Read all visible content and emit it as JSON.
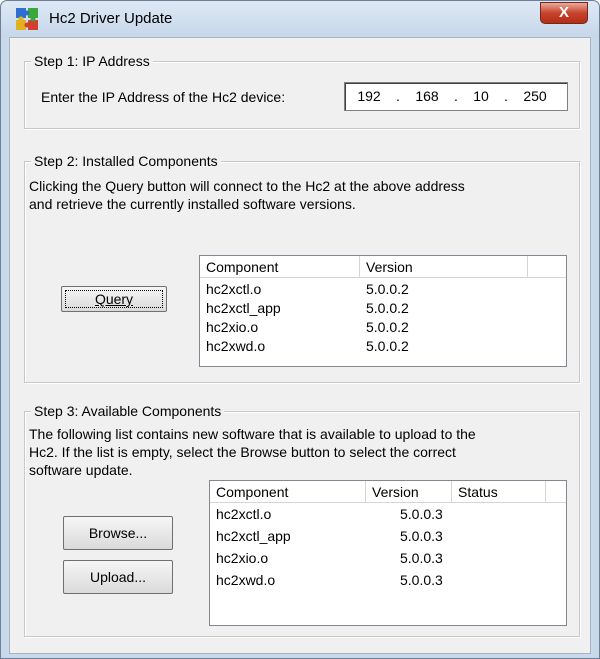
{
  "window": {
    "title": "Hc2 Driver Update",
    "close_glyph": "X"
  },
  "step1": {
    "legend": "Step 1: IP Address",
    "prompt": "Enter the IP Address of the Hc2 device:",
    "ip": {
      "o1": "192",
      "o2": "168",
      "o3": "10",
      "o4": "250",
      "dot": "."
    }
  },
  "step2": {
    "legend": "Step 2: Installed Components",
    "description_1": "Clicking the Query button will connect to the Hc2 at the above address",
    "description_2": "and retrieve the currently installed software versions.",
    "query_label": "Query",
    "columns": [
      "Component",
      "Version"
    ],
    "rows": [
      {
        "component": "hc2xctl.o",
        "version": "5.0.0.2"
      },
      {
        "component": "hc2xctl_app",
        "version": "5.0.0.2"
      },
      {
        "component": "hc2xio.o",
        "version": "5.0.0.2"
      },
      {
        "component": "hc2xwd.o",
        "version": "5.0.0.2"
      }
    ]
  },
  "step3": {
    "legend": "Step 3: Available Components",
    "description_1": "The following list contains new software that is available to upload to the",
    "description_2": "Hc2.  If the list is empty, select the Browse button to select the correct",
    "description_3": "software update.",
    "browse_label": "Browse...",
    "upload_label": "Upload...",
    "columns": [
      "Component",
      "Version",
      "Status"
    ],
    "rows": [
      {
        "component": "hc2xctl.o",
        "version": "5.0.0.3",
        "status": ""
      },
      {
        "component": "hc2xctl_app",
        "version": "5.0.0.3",
        "status": ""
      },
      {
        "component": "hc2xio.o",
        "version": "5.0.0.3",
        "status": ""
      },
      {
        "component": "hc2xwd.o",
        "version": "5.0.0.3",
        "status": ""
      }
    ]
  },
  "icons": {
    "app": "puzzle-icon",
    "close": "close-icon"
  },
  "colors": {
    "close_button": "#c7442c",
    "window_frame": "#c9d9ea"
  }
}
